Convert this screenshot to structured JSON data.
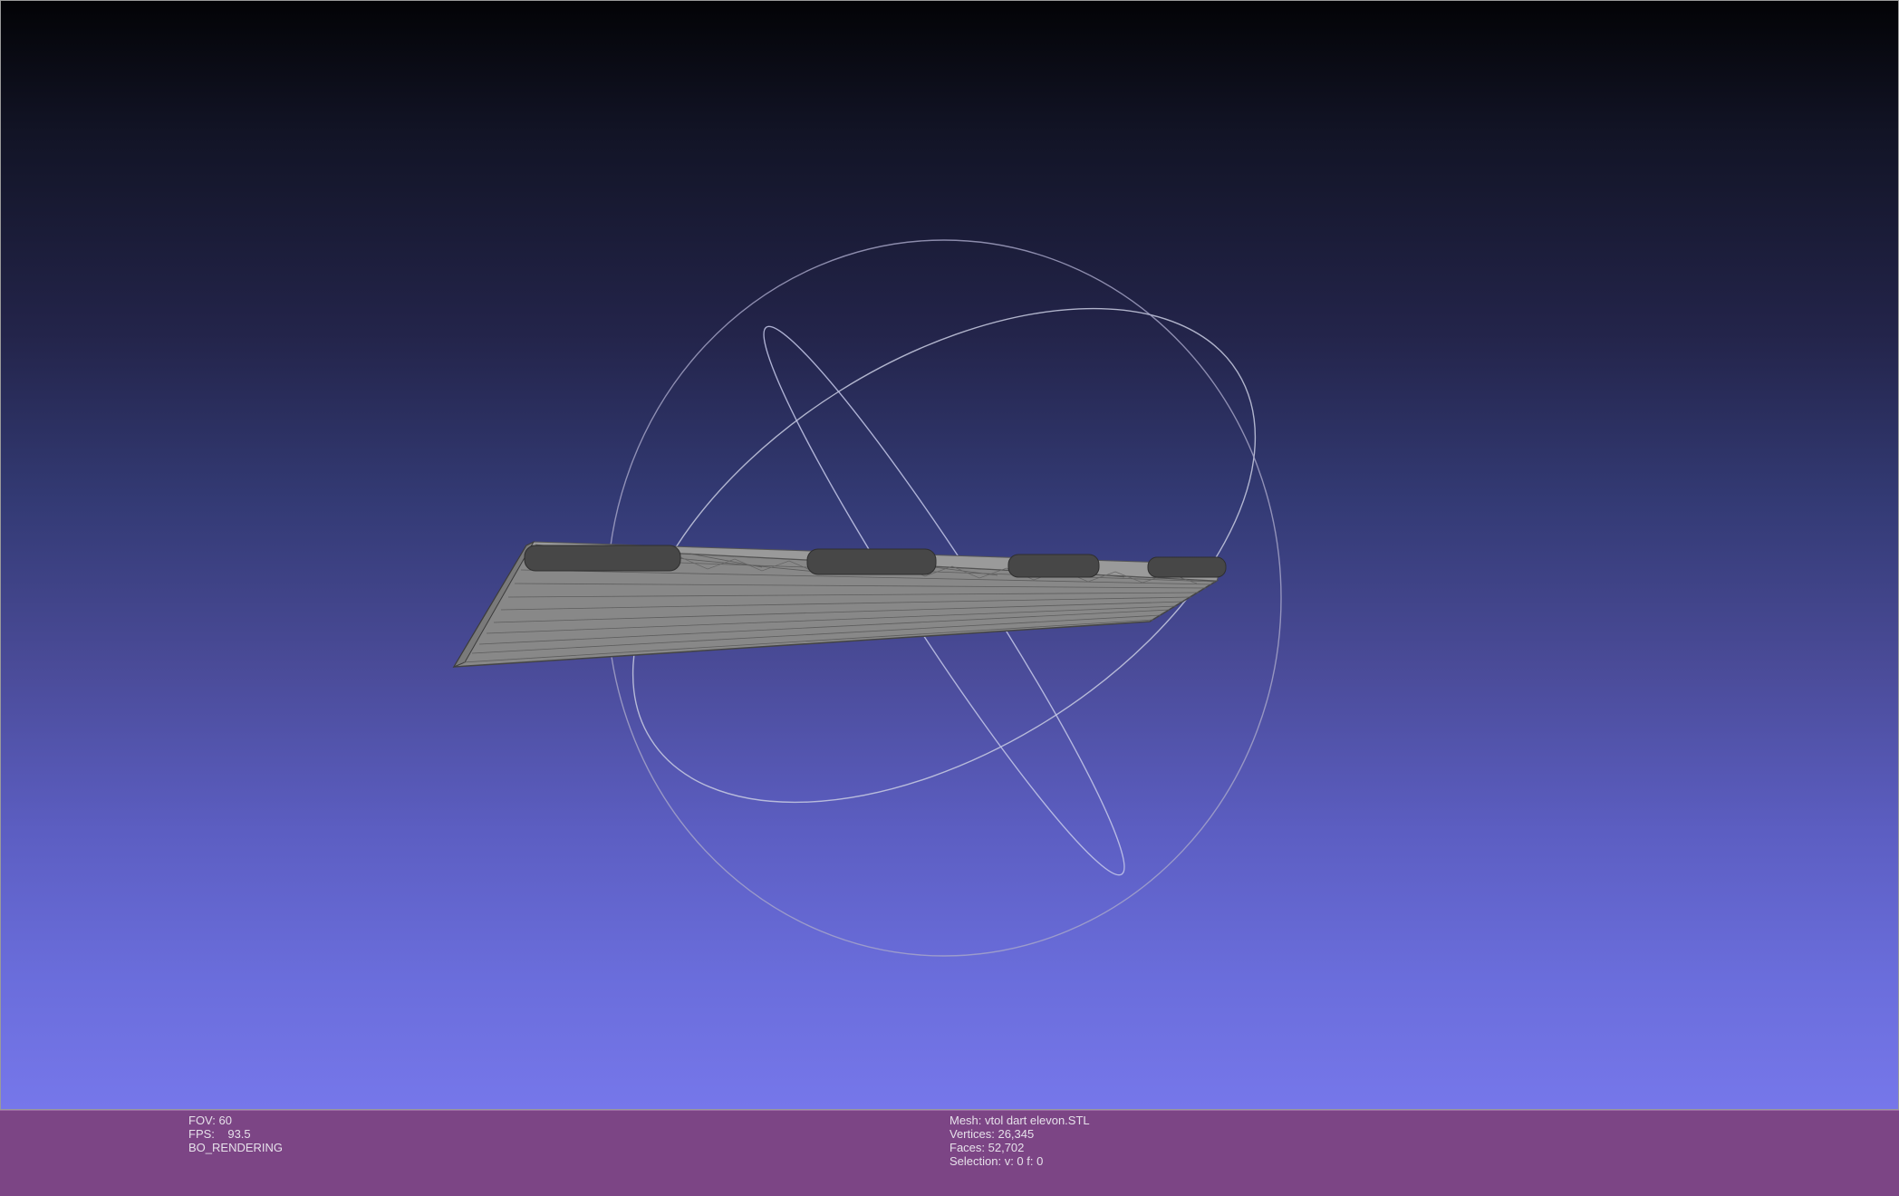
{
  "viewer": {
    "background_top": "#030306",
    "background_bottom": "#7677ea",
    "mesh_color": "#8e8e8e",
    "trackball_color": "#b8b8d6"
  },
  "info_left": {
    "fov": "FOV: 60",
    "fps": "FPS:    93.5",
    "render_mode": "BO_RENDERING"
  },
  "info_right": {
    "mesh": "Mesh: vtol dart elevon.STL",
    "vertices": "Vertices: 26,345",
    "faces": "Faces: 52,702",
    "selection": "Selection: v: 0 f: 0"
  },
  "info_bar_color": "#7c4585"
}
